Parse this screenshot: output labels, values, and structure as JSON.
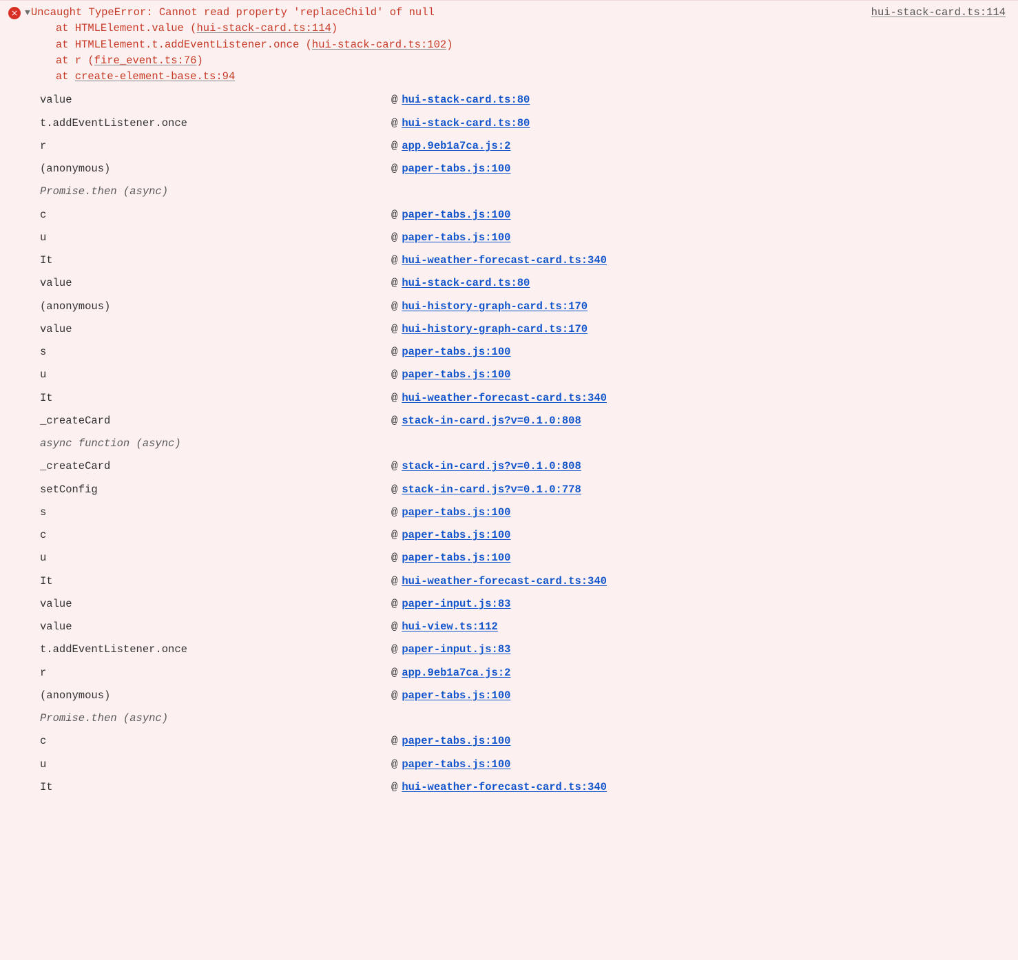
{
  "error": {
    "source_link": "hui-stack-card.ts:114",
    "message": "Uncaught TypeError: Cannot read property 'replaceChild' of null",
    "trace": [
      {
        "prefix": "at HTMLElement.value ",
        "link": "hui-stack-card.ts:114"
      },
      {
        "prefix": "at HTMLElement.t.addEventListener.once ",
        "link": "hui-stack-card.ts:102"
      },
      {
        "prefix": "at r ",
        "link": "fire_event.ts:76"
      },
      {
        "prefix": "at ",
        "link": "create-element-base.ts:94",
        "no_paren": true
      }
    ]
  },
  "stack": [
    {
      "fn": "value",
      "src": "hui-stack-card.ts:80"
    },
    {
      "fn": "t.addEventListener.once",
      "src": "hui-stack-card.ts:80"
    },
    {
      "fn": "r",
      "src": "app.9eb1a7ca.js:2"
    },
    {
      "fn": "(anonymous)",
      "src": "paper-tabs.js:100"
    },
    {
      "async": "Promise.then (async)"
    },
    {
      "fn": "c",
      "src": "paper-tabs.js:100"
    },
    {
      "fn": "u",
      "src": "paper-tabs.js:100"
    },
    {
      "fn": "It",
      "src": "hui-weather-forecast-card.ts:340"
    },
    {
      "fn": "value",
      "src": "hui-stack-card.ts:80"
    },
    {
      "fn": "(anonymous)",
      "src": "hui-history-graph-card.ts:170"
    },
    {
      "fn": "value",
      "src": "hui-history-graph-card.ts:170"
    },
    {
      "fn": "s",
      "src": "paper-tabs.js:100"
    },
    {
      "fn": "u",
      "src": "paper-tabs.js:100"
    },
    {
      "fn": "It",
      "src": "hui-weather-forecast-card.ts:340"
    },
    {
      "fn": "_createCard",
      "src": "stack-in-card.js?v=0.1.0:808"
    },
    {
      "async": "async function (async)"
    },
    {
      "fn": "_createCard",
      "src": "stack-in-card.js?v=0.1.0:808"
    },
    {
      "fn": "setConfig",
      "src": "stack-in-card.js?v=0.1.0:778"
    },
    {
      "fn": "s",
      "src": "paper-tabs.js:100"
    },
    {
      "fn": "c",
      "src": "paper-tabs.js:100"
    },
    {
      "fn": "u",
      "src": "paper-tabs.js:100"
    },
    {
      "fn": "It",
      "src": "hui-weather-forecast-card.ts:340"
    },
    {
      "fn": "value",
      "src": "paper-input.js:83"
    },
    {
      "fn": "value",
      "src": "hui-view.ts:112"
    },
    {
      "fn": "t.addEventListener.once",
      "src": "paper-input.js:83"
    },
    {
      "fn": "r",
      "src": "app.9eb1a7ca.js:2"
    },
    {
      "fn": "(anonymous)",
      "src": "paper-tabs.js:100"
    },
    {
      "async": "Promise.then (async)"
    },
    {
      "fn": "c",
      "src": "paper-tabs.js:100"
    },
    {
      "fn": "u",
      "src": "paper-tabs.js:100"
    },
    {
      "fn": "It",
      "src": "hui-weather-forecast-card.ts:340"
    }
  ],
  "at_symbol": "@"
}
